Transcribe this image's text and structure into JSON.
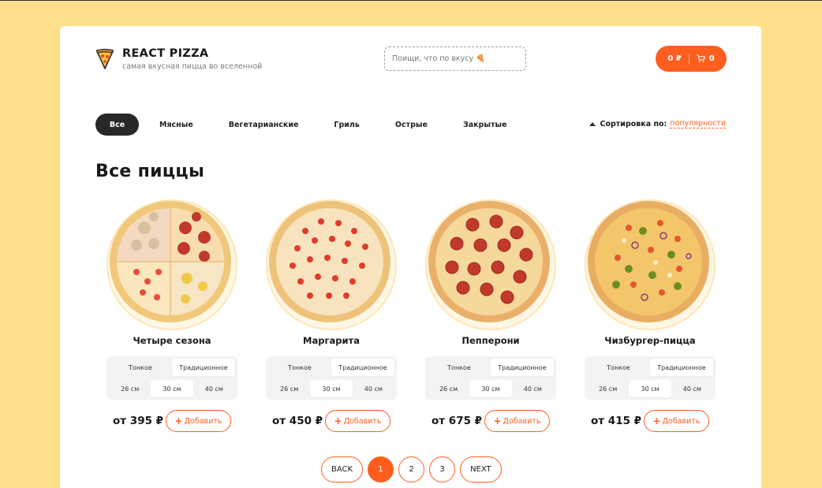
{
  "brand": {
    "title": "REACT PIZZA",
    "subtitle": "самая вкусная пицца во вселенной"
  },
  "search": {
    "placeholder": "Поищи, что по вкусу 🍕"
  },
  "cart": {
    "total": "0 ₽",
    "count": "0"
  },
  "categories": [
    {
      "label": "Все",
      "active": true
    },
    {
      "label": "Мясные"
    },
    {
      "label": "Вегетарианские"
    },
    {
      "label": "Гриль"
    },
    {
      "label": "Острые"
    },
    {
      "label": "Закрытые"
    }
  ],
  "sort": {
    "label": "Сортировка по:",
    "value": "популярности"
  },
  "page_title": "Все пиццы",
  "pizzas": [
    {
      "name": "Четыре сезона",
      "types": [
        "Тонкое",
        "Традиционное"
      ],
      "active_type": 1,
      "sizes": [
        "26 см",
        "30 см",
        "40 см"
      ],
      "active_size": 1,
      "price": "от 395 ₽",
      "add_label": "Добавить"
    },
    {
      "name": "Маргарита",
      "types": [
        "Тонкое",
        "Традиционное"
      ],
      "active_type": 1,
      "sizes": [
        "26 см",
        "30 см",
        "40 см"
      ],
      "active_size": 1,
      "price": "от 450 ₽",
      "add_label": "Добавить"
    },
    {
      "name": "Пепперони",
      "types": [
        "Тонкое",
        "Традиционное"
      ],
      "active_type": 1,
      "sizes": [
        "26 см",
        "30 см",
        "40 см"
      ],
      "active_size": 1,
      "price": "от 675 ₽",
      "add_label": "Добавить"
    },
    {
      "name": "Чизбургер-пицца",
      "types": [
        "Тонкое",
        "Традиционное"
      ],
      "active_type": 1,
      "sizes": [
        "26 см",
        "30 см",
        "40 см"
      ],
      "active_size": 1,
      "price": "от 415 ₽",
      "add_label": "Добавить"
    }
  ],
  "pagination": {
    "back": "BACK",
    "pages": [
      "1",
      "2",
      "3"
    ],
    "active_page": "1",
    "next": "NEXT"
  },
  "colors": {
    "accent": "#fe5f1e",
    "background": "#ffdf8c",
    "dark": "#282828"
  }
}
